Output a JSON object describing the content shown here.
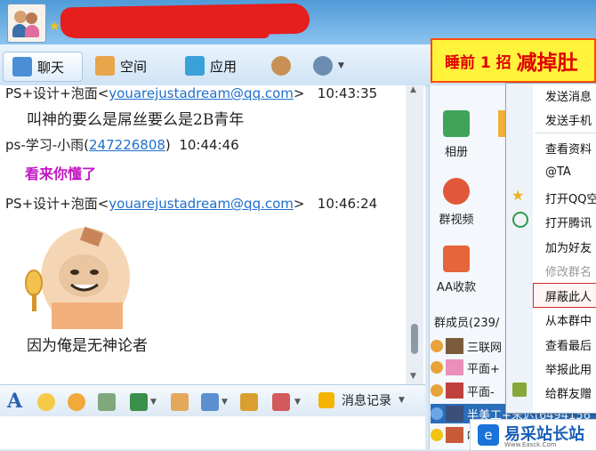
{
  "window": {
    "redacted_title": true
  },
  "tabs": [
    {
      "label": "聊天",
      "icon": "chat-icon"
    },
    {
      "label": "空间",
      "icon": "house-icon"
    },
    {
      "label": "应用",
      "icon": "apps-grid-icon"
    }
  ],
  "banner": {
    "small": "睡前 1 招",
    "big": "减掉肚"
  },
  "messages": [
    {
      "sender_pre": "PS+设计+泡面<",
      "sender_link": "youarejustadream@qq.com",
      "sender_post": ">",
      "time": "10:43:35",
      "text": "叫神的要么是屌丝要么是2B青年"
    },
    {
      "sender_pre": "ps-学习-小雨(",
      "sender_link": "247226808",
      "sender_post": ")",
      "time": "10:44:46",
      "text": "看来你懂了"
    },
    {
      "sender_pre": "PS+设计+泡面<",
      "sender_link": "youarejustadream@qq.com",
      "sender_post": ">",
      "time": "10:46:24",
      "text": "因为俺是无神论者"
    }
  ],
  "bottom_toolbar": {
    "history_label": "消息记录"
  },
  "group_apps": [
    {
      "label": "相册"
    },
    {
      "label": "群视频"
    },
    {
      "label": "AA收款"
    }
  ],
  "members": {
    "header": "群成员(239/",
    "items": [
      "三联网",
      "平面+",
      "平面-",
      "半美工+末迟(6494156",
      "啊"
    ]
  },
  "context_menu": {
    "items": [
      "发送消息",
      "发送手机",
      "查看资料",
      "@TA",
      "打开QQ空",
      "打开腾讯",
      "加为好友",
      "修改群名",
      "屏蔽此人",
      "从本群中",
      "查看最后",
      "举报此用",
      "给群友赠"
    ]
  },
  "watermark": {
    "text": "易采站长站",
    "url": "Www.Easck.Com"
  }
}
